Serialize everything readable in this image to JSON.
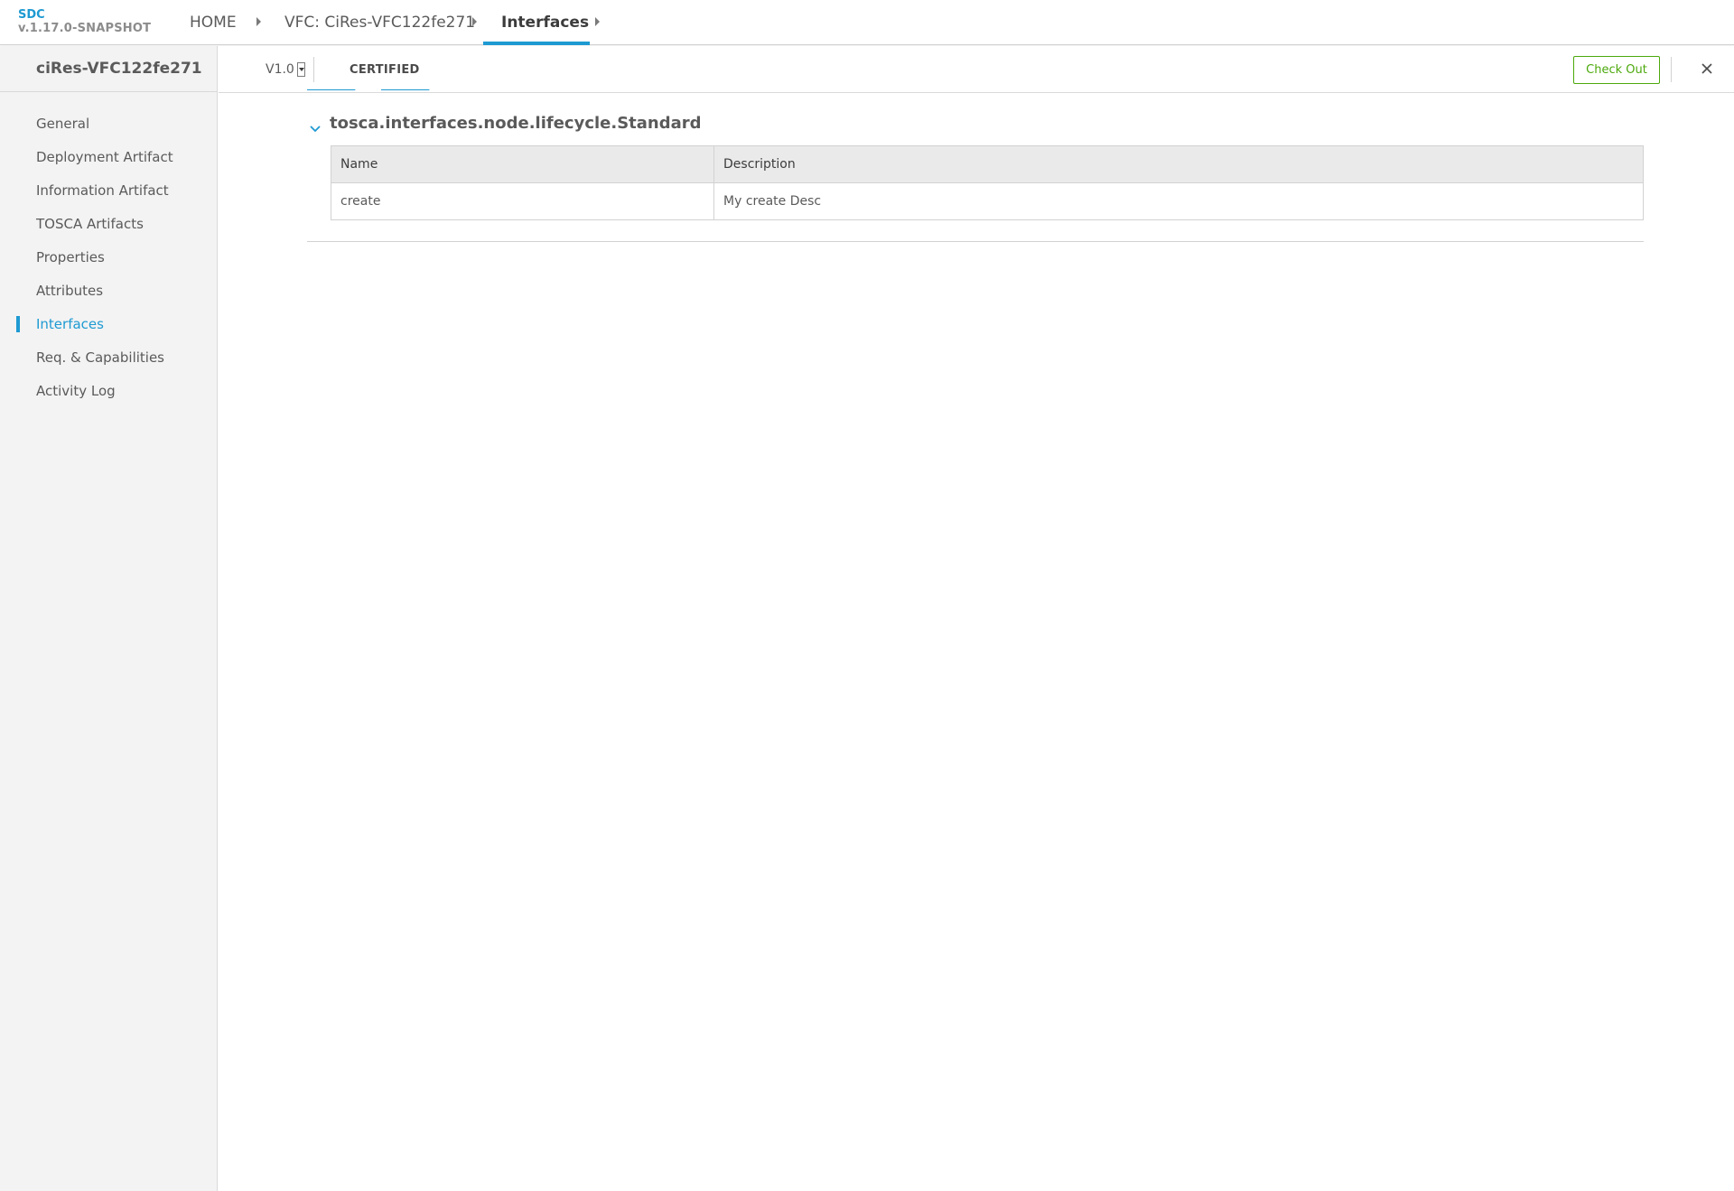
{
  "app": {
    "brand": "SDC",
    "version": "v.1.17.0-SNAPSHOT"
  },
  "breadcrumb": {
    "items": [
      "HOME",
      "VFC: CiRes-VFC122fe271",
      "Interfaces"
    ]
  },
  "sidebar": {
    "title": "ciRes-VFC122fe271",
    "items": [
      {
        "label": "General"
      },
      {
        "label": "Deployment Artifact"
      },
      {
        "label": "Information Artifact"
      },
      {
        "label": "TOSCA Artifacts"
      },
      {
        "label": "Properties"
      },
      {
        "label": "Attributes"
      },
      {
        "label": "Interfaces"
      },
      {
        "label": "Req. & Capabilities"
      },
      {
        "label": "Activity Log"
      }
    ],
    "selected": "Interfaces"
  },
  "header": {
    "version": "V1.0",
    "status": "CERTIFIED",
    "checkout_label": "Check Out"
  },
  "interfaces": [
    {
      "name": "tosca.interfaces.node.lifecycle.Standard",
      "columns": [
        "Name",
        "Description"
      ],
      "operations": [
        {
          "name": "create",
          "description": "My create Desc"
        }
      ]
    }
  ],
  "colors": {
    "accent": "#1e9ad2",
    "checkout": "#4ca90c"
  }
}
